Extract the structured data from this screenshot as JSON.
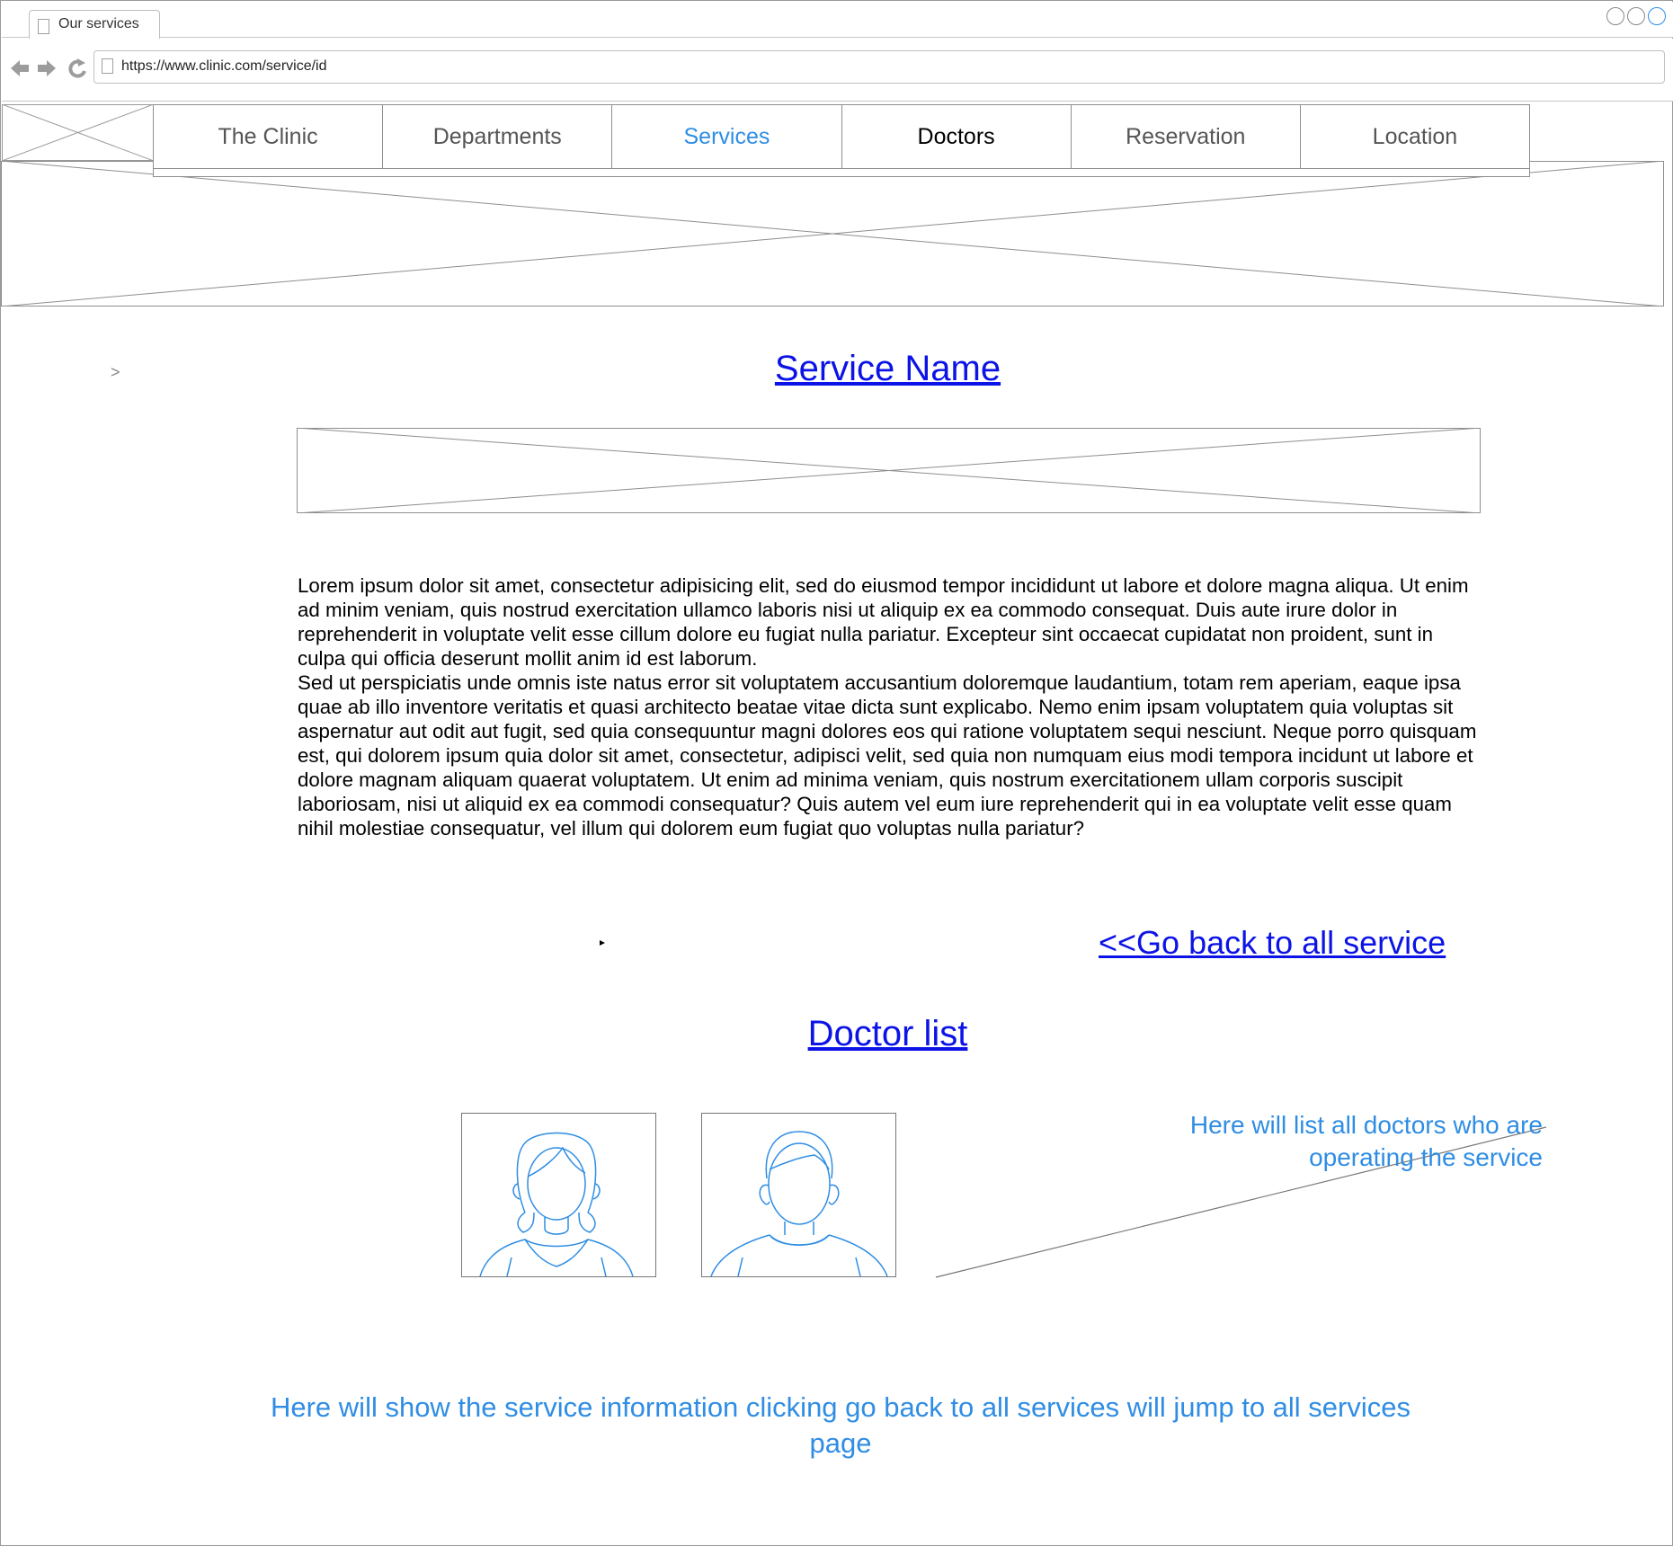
{
  "browser": {
    "tab_title": "Our services",
    "url": "https://www.clinic.com/service/id"
  },
  "menu": {
    "items": [
      {
        "label": "The Clinic",
        "state": "normal"
      },
      {
        "label": "Departments",
        "state": "normal"
      },
      {
        "label": "Services",
        "state": "active"
      },
      {
        "label": "Doctors",
        "state": "hover"
      },
      {
        "label": "Reservation",
        "state": "normal"
      },
      {
        "label": "Location",
        "state": "normal"
      }
    ]
  },
  "breadcrumb": ">",
  "service": {
    "title": "Service Name",
    "paragraphs": [
      "Lorem ipsum dolor sit amet, consectetur adipisicing elit, sed do eiusmod tempor incididunt ut labore et dolore magna aliqua. Ut enim ad minim veniam, quis nostrud exercitation ullamco laboris nisi ut aliquip ex ea commodo consequat. Duis aute irure dolor in reprehenderit in voluptate velit esse cillum dolore eu fugiat nulla pariatur. Excepteur sint occaecat cupidatat non proident, sunt in culpa qui officia deserunt mollit anim id est laborum.",
      "Sed ut perspiciatis unde omnis iste natus error sit voluptatem accusantium doloremque laudantium, totam rem aperiam, eaque ipsa quae ab illo inventore veritatis et quasi architecto beatae vitae dicta sunt explicabo. Nemo enim ipsam voluptatem quia voluptas sit aspernatur aut odit aut fugit, sed quia consequuntur magni dolores eos qui ratione voluptatem sequi nesciunt. Neque porro quisquam est, qui dolorem ipsum quia dolor sit amet, consectetur, adipisci velit, sed quia non numquam eius modi tempora incidunt ut labore et dolore magnam aliquam quaerat voluptatem. Ut enim ad minima veniam, quis nostrum exercitationem ullam corporis suscipit laboriosam, nisi ut aliquid ex ea commodi consequatur? Quis autem vel eum iure reprehenderit qui in ea voluptate velit esse quam nihil molestiae consequatur, vel illum qui dolorem eum fugiat quo voluptas nulla pariatur?"
    ],
    "back_link": "<<Go back to all service"
  },
  "doctors": {
    "title": "Doctor list",
    "cards": [
      {
        "icon": "female-avatar-icon"
      },
      {
        "icon": "male-avatar-icon"
      }
    ]
  },
  "annotations": {
    "doctors_note": "Here will list all doctors who are operating the service",
    "page_note": "Here will show the service information clicking go back to all services will jump to all services page"
  },
  "colors": {
    "link": "#0b13e6",
    "annotation": "#2f8de4",
    "active_menu": "#2f8de4"
  }
}
